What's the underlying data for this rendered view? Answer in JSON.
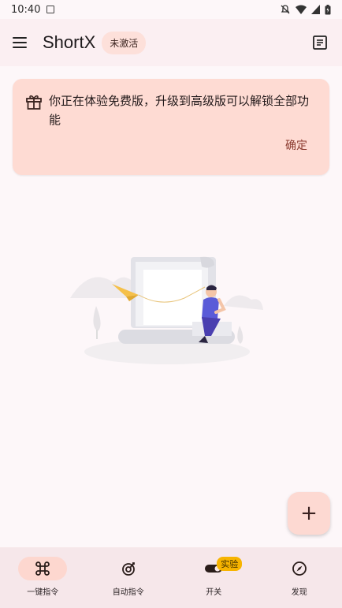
{
  "status_bar": {
    "time": "10:40"
  },
  "app_bar": {
    "title": "ShortX",
    "badge": "未激活"
  },
  "banner": {
    "message": "你正在体验免费版，升级到高级版可以解锁全部功能",
    "confirm_label": "确定"
  },
  "fab": {
    "label": "+"
  },
  "bottom_nav": {
    "items": [
      {
        "label": "一键指令",
        "icon": "command-icon",
        "active": true
      },
      {
        "label": "自动指令",
        "icon": "auto-target-icon",
        "active": false
      },
      {
        "label": "开关",
        "icon": "toggle-icon",
        "active": false,
        "badge": "实验"
      },
      {
        "label": "发现",
        "icon": "compass-icon",
        "active": false
      }
    ]
  },
  "colors": {
    "accent": "#fdd7cf",
    "banner_bg": "#fedbd3",
    "confirm_text": "#8b3a2f",
    "illustration_person": "#5a5bd8",
    "illustration_plane": "#f5c04a"
  }
}
